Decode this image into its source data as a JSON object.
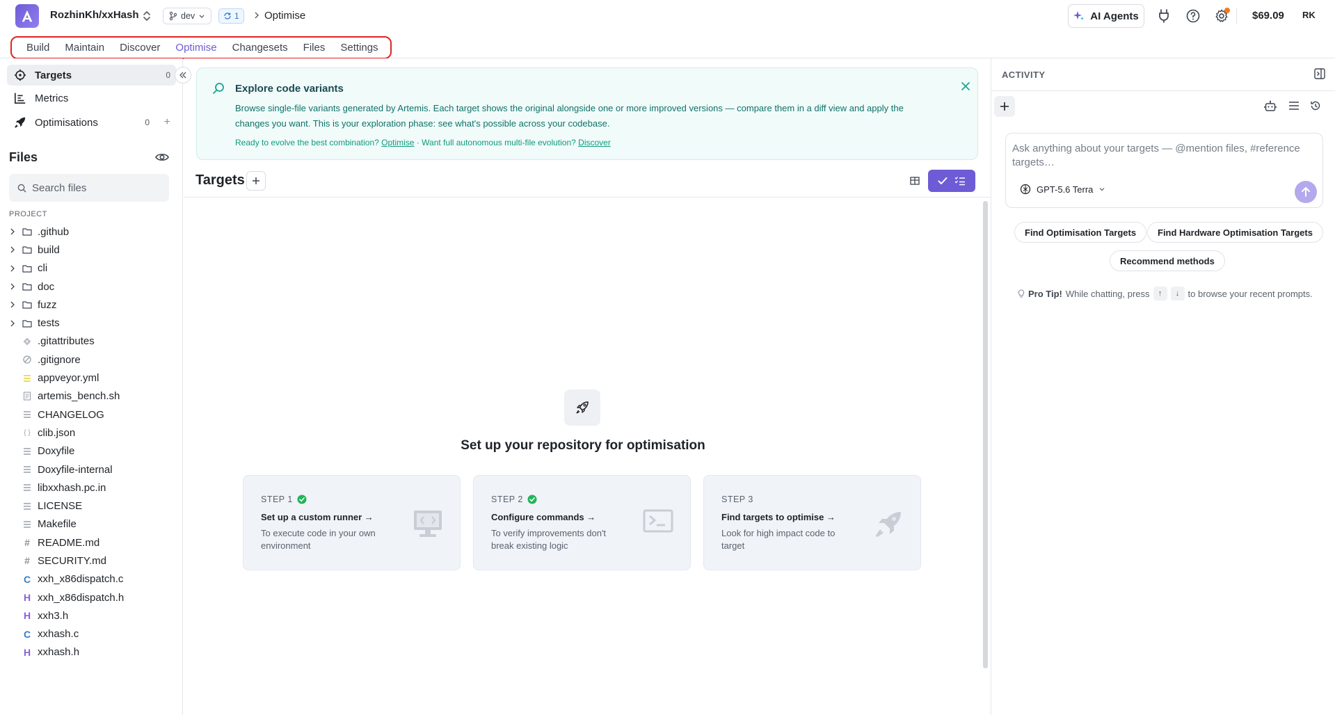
{
  "header": {
    "repo_name": "RozhinKh/xxHash",
    "branch": "dev",
    "sync_count": "1",
    "breadcrumb": "Optimise",
    "ai_agents_label": "AI Agents",
    "credits": "$69.09",
    "avatar_initials": "RK"
  },
  "nav": {
    "items": [
      {
        "label": "Build"
      },
      {
        "label": "Maintain"
      },
      {
        "label": "Discover"
      },
      {
        "label": "Optimise"
      },
      {
        "label": "Changesets"
      },
      {
        "label": "Files"
      },
      {
        "label": "Settings"
      }
    ],
    "active": "Optimise"
  },
  "sidebar": {
    "items": [
      {
        "label": "Targets",
        "count": "0",
        "icon": "crosshair-icon"
      },
      {
        "label": "Metrics",
        "icon": "bar-chart-icon"
      },
      {
        "label": "Optimisations",
        "count": "0",
        "icon": "rocket-icon"
      }
    ],
    "files_title": "Files",
    "search_placeholder": "Search files",
    "project_label": "PROJECT",
    "folders": [
      ".github",
      "build",
      "cli",
      "doc",
      "fuzz",
      "tests"
    ],
    "files": [
      {
        "name": ".gitattributes",
        "icon": "git-diamond-icon"
      },
      {
        "name": ".gitignore",
        "icon": "ban-icon"
      },
      {
        "name": "appveyor.yml",
        "icon": "yaml-lines-icon"
      },
      {
        "name": "artemis_bench.sh",
        "icon": "script-icon"
      },
      {
        "name": "CHANGELOG",
        "icon": "text-lines-icon"
      },
      {
        "name": "clib.json",
        "icon": "json-braces-icon"
      },
      {
        "name": "Doxyfile",
        "icon": "text-lines-icon"
      },
      {
        "name": "Doxyfile-internal",
        "icon": "text-lines-icon"
      },
      {
        "name": "libxxhash.pc.in",
        "icon": "text-lines-icon"
      },
      {
        "name": "LICENSE",
        "icon": "text-lines-icon"
      },
      {
        "name": "Makefile",
        "icon": "text-lines-icon"
      },
      {
        "name": "README.md",
        "icon": "hash-icon",
        "glyph": "#"
      },
      {
        "name": "SECURITY.md",
        "icon": "hash-icon",
        "glyph": "#"
      },
      {
        "name": "xxh_x86dispatch.c",
        "icon": "c-file-icon",
        "glyph": "C"
      },
      {
        "name": "xxh_x86dispatch.h",
        "icon": "h-file-icon",
        "glyph": "H"
      },
      {
        "name": "xxh3.h",
        "icon": "h-file-icon",
        "glyph": "H"
      },
      {
        "name": "xxhash.c",
        "icon": "c-file-icon",
        "glyph": "C"
      },
      {
        "name": "xxhash.h",
        "icon": "h-file-icon",
        "glyph": "H"
      }
    ]
  },
  "banner": {
    "title": "Explore code variants",
    "text": "Browse single-file variants generated by Artemis. Each target shows the original alongside one or more improved versions — compare them in a diff view and apply the changes you want. This is your exploration phase: see what's possible across your codebase.",
    "link_line_prefix": "Ready to evolve the best combination?",
    "link_optimise": "Optimise",
    "link_line_middle": "· Want full autonomous multi-file evolution?",
    "link_discover": "Discover"
  },
  "targets": {
    "title": "Targets",
    "empty_title": "Set up your repository for optimisation",
    "steps": [
      {
        "label": "STEP 1",
        "done": true,
        "title": "Set up a custom runner →",
        "desc": "To execute code in your own environment",
        "art": "monitor-code-icon"
      },
      {
        "label": "STEP 2",
        "done": true,
        "title": "Configure commands →",
        "desc": "To verify improvements don't break existing logic",
        "art": "terminal-icon"
      },
      {
        "label": "STEP 3",
        "done": false,
        "title": "Find targets to optimise →",
        "desc": "Look for high impact code to target",
        "art": "rocket-icon"
      }
    ]
  },
  "activity": {
    "title": "ACTIVITY",
    "chat_placeholder": "Ask anything about your targets — @mention files, #reference targets…",
    "model": "GPT-5.6 Terra",
    "chips": [
      "Find Optimisation Targets",
      "Find Hardware Optimisation Targets",
      "Recommend methods"
    ],
    "protip_label": "Pro Tip!",
    "protip_text_1": "While chatting, press",
    "protip_key_up": "↑",
    "protip_key_down": "↓",
    "protip_text_2": "to browse your recent prompts."
  },
  "colors": {
    "accent": "#6e5bd6",
    "teal": "#0e7268",
    "success": "#22b55a",
    "highlight_border": "#e02424"
  }
}
